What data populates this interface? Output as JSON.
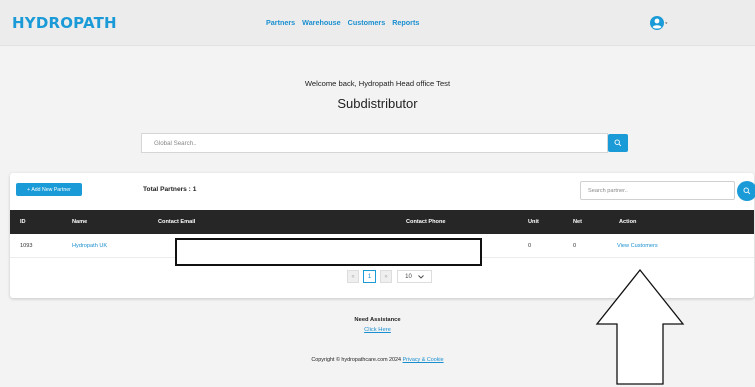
{
  "header": {
    "logo": "HYDROPATH",
    "nav": [
      "Partners",
      "Warehouse",
      "Customers",
      "Reports"
    ],
    "accent_color": "#1a9bd7"
  },
  "main": {
    "welcome": "Welcome back, Hydropath Head office Test",
    "title": "Subdistributor",
    "global_search_placeholder": "Global Search.."
  },
  "partners": {
    "add_button": "+ Add New Partner",
    "total_label": "Total Partners : 1",
    "search_placeholder": "Search partner..",
    "columns": [
      "ID",
      "Name",
      "Contact Email",
      "Contact Phone",
      "Unit",
      "Net",
      "Action"
    ],
    "rows": [
      {
        "id": "1093",
        "name": "Hydropath UK",
        "email": "",
        "phone": "",
        "unit": "0",
        "net": "0",
        "action": "View Customers"
      }
    ]
  },
  "pagination": {
    "prev": "«",
    "current": "1",
    "next": "»",
    "page_size": "10"
  },
  "footer": {
    "assist": "Need Assistance",
    "click_here": "Click Here",
    "copyright": "Copyright © hydropathcare.com 2024",
    "privacy": "Privacy & Cookie"
  }
}
